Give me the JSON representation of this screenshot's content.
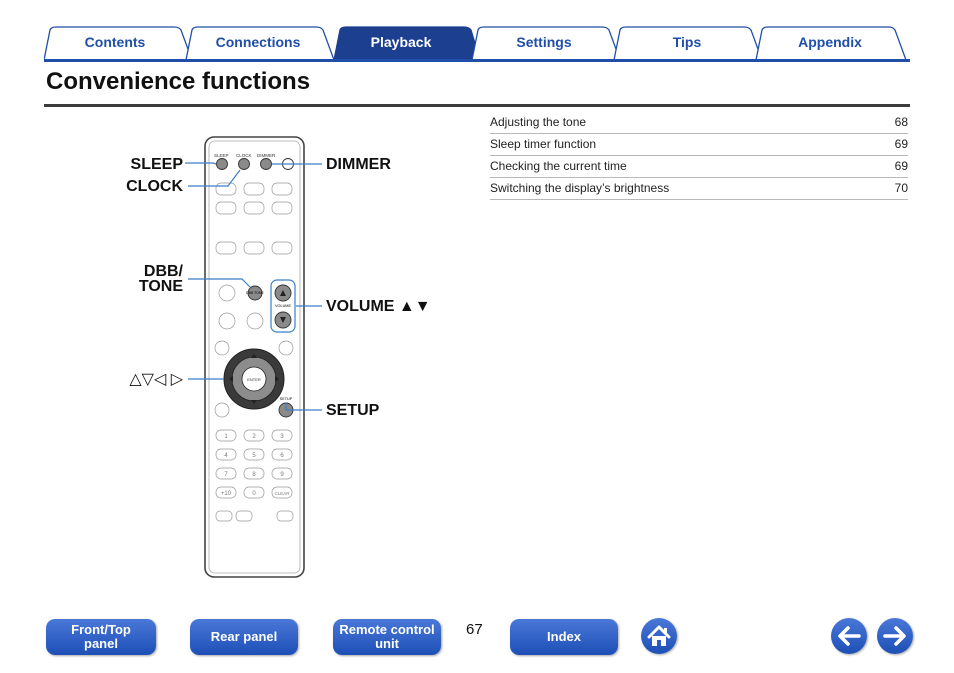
{
  "tabs": [
    {
      "label": "Contents",
      "active": false
    },
    {
      "label": "Connections",
      "active": false
    },
    {
      "label": "Playback",
      "active": true
    },
    {
      "label": "Settings",
      "active": false
    },
    {
      "label": "Tips",
      "active": false
    },
    {
      "label": "Appendix",
      "active": false
    }
  ],
  "page_title": "Convenience functions",
  "toc": [
    {
      "text": "Adjusting the tone",
      "page": "68"
    },
    {
      "text": "Sleep timer function",
      "page": "69"
    },
    {
      "text": "Checking the current time",
      "page": "69"
    },
    {
      "text": "Switching the display’s brightness",
      "page": "70"
    }
  ],
  "callouts": {
    "sleep": "SLEEP",
    "clock": "CLOCK",
    "dimmer": "DIMMER",
    "dbb_tone_1": "DBB/",
    "dbb_tone_2": "TONE",
    "volume": "VOLUME ▲▼",
    "cursors": "△▽◁ ▷",
    "setup": "SETUP"
  },
  "remote": {
    "top_labels": [
      "SLEEP",
      "CLOCK",
      "DIMMER"
    ],
    "enter_label": "ENTER",
    "setup_label": "SETUP",
    "volume_label": "VOLUME",
    "dbb_label": "DBB TONE",
    "number_keys": [
      "1",
      "2",
      "3",
      "4",
      "5",
      "6",
      "7",
      "8",
      "9",
      "+10",
      "0",
      "CLEAR"
    ]
  },
  "footer": {
    "front_top_panel": "Front/Top\npanel",
    "rear_panel": "Rear panel",
    "remote_control_unit": "Remote control\nunit",
    "page_number": "67",
    "index": "Index"
  },
  "colors": {
    "accent_blue": "#1f4fa8",
    "button_blue": "#2d5fc4",
    "tab_active": "#1c3f8f",
    "callout_line": "#3a7fc8"
  },
  "icons": [
    "home-icon",
    "arrow-left-icon",
    "arrow-right-icon"
  ]
}
